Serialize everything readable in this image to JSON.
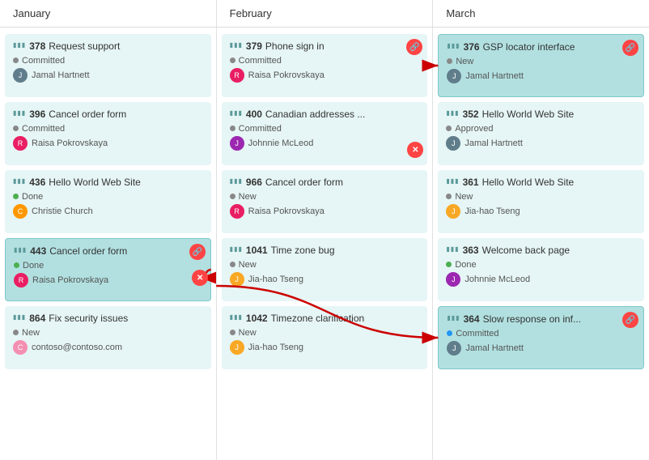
{
  "header": {
    "columns": [
      "January",
      "February",
      "March"
    ]
  },
  "columns": [
    {
      "id": "january",
      "cards": [
        {
          "id": "378",
          "name": "Request support",
          "status": "Committed",
          "status_type": "committed",
          "user": "Jamal Hartnett",
          "avatar_type": "jamal",
          "highlighted": false,
          "has_link": false
        },
        {
          "id": "396",
          "name": "Cancel order form",
          "status": "Committed",
          "status_type": "committed",
          "user": "Raisa Pokrovskaya",
          "avatar_type": "raisa",
          "highlighted": false,
          "has_link": false
        },
        {
          "id": "436",
          "name": "Hello World Web Site",
          "status": "Done",
          "status_type": "done",
          "user": "Christie Church",
          "avatar_type": "christie",
          "highlighted": false,
          "has_link": false
        },
        {
          "id": "443",
          "name": "Cancel order form",
          "status": "Done",
          "status_type": "done-green",
          "user": "Raisa Pokrovskaya",
          "avatar_type": "raisa",
          "highlighted": true,
          "has_link": true
        },
        {
          "id": "864",
          "name": "Fix security issues",
          "status": "New",
          "status_type": "new",
          "user": "contoso@contoso.com",
          "avatar_type": "contoso",
          "highlighted": false,
          "has_link": false
        }
      ]
    },
    {
      "id": "february",
      "cards": [
        {
          "id": "379",
          "name": "Phone sign in",
          "status": "Committed",
          "status_type": "committed",
          "user": "Raisa Pokrovskaya",
          "avatar_type": "raisa",
          "highlighted": false,
          "has_link": true
        },
        {
          "id": "400",
          "name": "Canadian addresses ...",
          "status": "Committed",
          "status_type": "committed",
          "user": "Johnnie McLeod",
          "avatar_type": "johnnie",
          "highlighted": false,
          "has_link": false
        },
        {
          "id": "966",
          "name": "Cancel order form",
          "status": "New",
          "status_type": "new",
          "user": "Raisa Pokrovskaya",
          "avatar_type": "raisa",
          "highlighted": false,
          "has_link": false
        },
        {
          "id": "1041",
          "name": "Time zone bug",
          "status": "New",
          "status_type": "new",
          "user": "Jia-hao Tseng",
          "avatar_type": "jia",
          "highlighted": false,
          "has_link": false
        },
        {
          "id": "1042",
          "name": "Timezone clarification",
          "status": "New",
          "status_type": "new",
          "user": "Jia-hao Tseng",
          "avatar_type": "jia",
          "highlighted": false,
          "has_link": false
        }
      ]
    },
    {
      "id": "march",
      "cards": [
        {
          "id": "376",
          "name": "GSP locator interface",
          "status": "New",
          "status_type": "new",
          "user": "Jamal Hartnett",
          "avatar_type": "jamal",
          "highlighted": true,
          "has_link": true
        },
        {
          "id": "352",
          "name": "Hello World Web Site",
          "status": "Approved",
          "status_type": "approved",
          "user": "Jamal Hartnett",
          "avatar_type": "jamal",
          "highlighted": false,
          "has_link": false
        },
        {
          "id": "361",
          "name": "Hello World Web Site",
          "status": "New",
          "status_type": "new",
          "user": "Jia-hao Tseng",
          "avatar_type": "jia",
          "highlighted": false,
          "has_link": false
        },
        {
          "id": "363",
          "name": "Welcome back page",
          "status": "Done",
          "status_type": "done",
          "user": "Johnnie McLeod",
          "avatar_type": "johnnie",
          "highlighted": false,
          "has_link": false
        },
        {
          "id": "364",
          "name": "Slow response on inf...",
          "status": "Committed",
          "status_type": "committed-blue",
          "user": "Jamal Hartnett",
          "avatar_type": "jamal",
          "highlighted": true,
          "has_link": true
        }
      ]
    }
  ]
}
